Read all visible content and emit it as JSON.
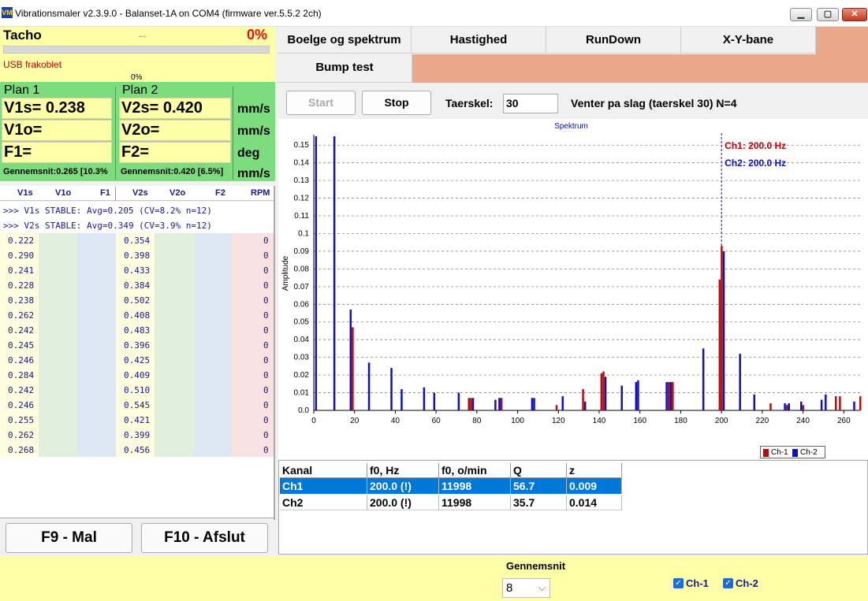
{
  "window": {
    "title": "Vibrationsmaler v2.3.9.0 - Balanset-1A on COM4 (firmware ver.5.5.2 2ch)",
    "app_icon_text": "VM",
    "minimize": "▁",
    "maximize": "▢",
    "close": "✕"
  },
  "tacho": {
    "title": "Tacho",
    "value": "--",
    "percent": "0%",
    "status": "USB frakoblet",
    "progress_label": "0%",
    "progress_fraction": 0
  },
  "plans": {
    "plan1": {
      "title": "Plan 1",
      "v1s": "V1s= 0.238",
      "v1o": "V1o=",
      "f1": "F1=",
      "avg": "Gennemsnit:0.265 [10.3%"
    },
    "plan2": {
      "title": "Plan 2",
      "v2s": "V2s= 0.420",
      "v2o": "V2o=",
      "f2": "F2=",
      "avg": "Gennemsnit:0.420 [6.5%]"
    },
    "units": [
      "mm/s",
      "mm/s",
      "deg",
      "mm/s"
    ]
  },
  "grid": {
    "headers": [
      "V1s",
      "V1o",
      "F1",
      "V2s",
      "V2o",
      "F2",
      "RPM"
    ],
    "log": [
      ">>> V1s STABLE: Avg=0.205 (CV=8.2% n=12)",
      ">>> V2s STABLE: Avg=0.349 (CV=3.9% n=12)"
    ],
    "v1s": [
      "0.222",
      "0.290",
      "0.241",
      "0.228",
      "0.238",
      "0.262",
      "0.242",
      "0.245",
      "0.246",
      "0.284",
      "0.242",
      "0.246",
      "0.255",
      "0.262",
      "0.268"
    ],
    "v2s": [
      "0.354",
      "0.398",
      "0.433",
      "0.384",
      "0.502",
      "0.408",
      "0.483",
      "0.396",
      "0.425",
      "0.409",
      "0.510",
      "0.545",
      "0.421",
      "0.399",
      "0.456"
    ],
    "rpm": [
      "0",
      "0",
      "0",
      "0",
      "0",
      "0",
      "0",
      "0",
      "0",
      "0",
      "0",
      "0",
      "0",
      "0",
      "0"
    ]
  },
  "buttons": {
    "f9": "F9 - Mal",
    "f10": "F10 - Afslut",
    "start": "Start",
    "stop": "Stop"
  },
  "tabs": [
    "Boelge og spektrum",
    "Hastighed",
    "RunDown",
    "X-Y-bane",
    "Bump test"
  ],
  "bump": {
    "threshold_label": "Taerskel:",
    "threshold_value": "30",
    "status": "Venter pa slag (taerskel 30)  N=4"
  },
  "chart_data": {
    "type": "bar",
    "title": "Spektrum",
    "xlabel": "",
    "ylabel": "Amplitude",
    "xlim": [
      0,
      268
    ],
    "ylim": [
      0,
      0.155
    ],
    "xticks": [
      0,
      20,
      40,
      60,
      80,
      100,
      120,
      140,
      160,
      180,
      200,
      220,
      240,
      260
    ],
    "yticks": [
      0.0,
      0.01,
      0.02,
      0.03,
      0.04,
      0.05,
      0.06,
      0.07,
      0.08,
      0.09,
      0.1,
      0.11,
      0.12,
      0.13,
      0.14,
      0.15
    ],
    "ytick_labels": [
      "0.0",
      "0.01",
      "0.02",
      "0.03",
      "0.04",
      "0.05",
      "0.06",
      "0.07",
      "0.08",
      "0.09",
      "0.1",
      "0.11",
      "0.12",
      "0.13",
      "0.14",
      "0.15"
    ],
    "grid": true,
    "legend_placement": "bottom-right",
    "marker_line_x": 200,
    "annotations": [
      {
        "text": "Ch1: 200.0 Hz",
        "color": "#c00000"
      },
      {
        "text": "Ch2: 200.0 Hz",
        "color": "#1010c0"
      }
    ],
    "series": [
      {
        "name": "Ch-1",
        "color": "#b01010",
        "x": [
          19,
          76,
          77,
          91,
          92,
          119,
          132,
          141,
          142,
          174,
          176,
          199,
          200,
          224,
          232,
          240,
          256,
          258,
          268
        ],
        "y": [
          0.047,
          0.007,
          0.007,
          0.007,
          0.007,
          0.003,
          0.012,
          0.021,
          0.022,
          0.016,
          0.016,
          0.074,
          0.093,
          0.004,
          0.003,
          0.003,
          0.008,
          0.008,
          0.008
        ]
      },
      {
        "name": "Ch-2",
        "color": "#1010c0",
        "x": [
          1,
          10,
          18,
          27,
          38,
          43,
          54,
          59,
          71,
          78,
          89,
          91,
          107,
          108,
          122,
          133,
          143,
          151,
          158,
          159,
          173,
          175,
          191,
          201,
          209,
          216,
          231,
          233,
          239,
          249,
          251,
          265
        ],
        "y": [
          0.155,
          0.155,
          0.057,
          0.027,
          0.024,
          0.012,
          0.013,
          0.01,
          0.01,
          0.007,
          0.006,
          0.007,
          0.007,
          0.007,
          0.008,
          0.005,
          0.019,
          0.014,
          0.016,
          0.017,
          0.016,
          0.016,
          0.035,
          0.09,
          0.032,
          0.009,
          0.004,
          0.004,
          0.005,
          0.006,
          0.009,
          0.005
        ]
      }
    ]
  },
  "results_table": {
    "headers": [
      "Kanal",
      "f0, Hz",
      "f0, o/min",
      "Q",
      "z"
    ],
    "rows": [
      [
        "Ch1",
        "200.0 (!)",
        "11998",
        "56.7",
        "0.009"
      ],
      [
        "Ch2",
        "200.0 (!)",
        "11998",
        "35.7",
        "0.014"
      ]
    ],
    "selected_color": "#0078d7"
  },
  "bottom": {
    "avg_label": "Gennemsnit",
    "avg_value": "8",
    "ch1_label": "Ch-1",
    "ch2_label": "Ch-2",
    "dropdown_arrow": "⌵",
    "check": "✓"
  }
}
